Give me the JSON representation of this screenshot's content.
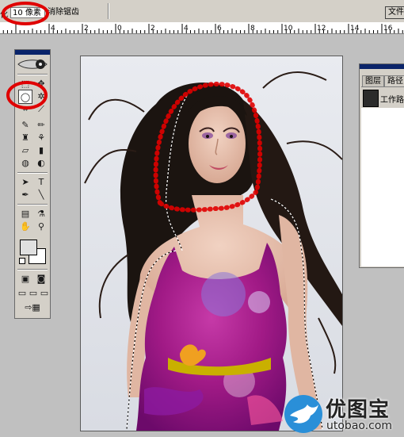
{
  "options_bar": {
    "feather_label_fragment": "化",
    "feather_value": "10 像素",
    "anti_alias_label": "消除锯齿",
    "file_button": "文件"
  },
  "ruler": {
    "ticks": [
      "4",
      "2",
      "0",
      "2",
      "4",
      "6",
      "8",
      "10",
      "12",
      "14",
      "16"
    ]
  },
  "panel": {
    "tabs": [
      "图层",
      "路径"
    ],
    "path_item": "工作路径"
  },
  "watermark": {
    "cn": "优图宝",
    "en": "utobao.com"
  },
  "colors": {
    "ui_gray": "#d4d0c8",
    "title_blue": "#0a246a",
    "highlight_red": "#e00000",
    "watermark_blue": "#2a8fd8"
  },
  "tools": {
    "active": "lasso-tool"
  }
}
